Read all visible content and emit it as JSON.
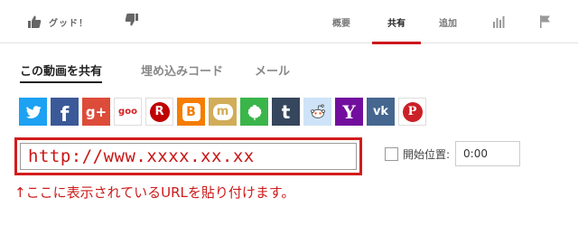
{
  "action_bar": {
    "like_label": "グッド！",
    "tabs": [
      {
        "label": "概要"
      },
      {
        "label": "共有"
      },
      {
        "label": "追加"
      }
    ]
  },
  "share": {
    "subtabs": [
      {
        "label": "この動画を共有"
      },
      {
        "label": "埋め込みコード"
      },
      {
        "label": "メール"
      }
    ],
    "services": [
      {
        "name": "twitter",
        "glyph": "",
        "color": "#1da1f2"
      },
      {
        "name": "facebook",
        "glyph": "f",
        "color": "#3b5998"
      },
      {
        "name": "google-plus",
        "glyph": "g+",
        "color": "#dd4b39"
      },
      {
        "name": "goo",
        "glyph": "goo",
        "color": "#ffffff"
      },
      {
        "name": "rakuten",
        "glyph": "R",
        "color": "#ffffff"
      },
      {
        "name": "blogger",
        "glyph": "B",
        "color": "#f57d00"
      },
      {
        "name": "mixi",
        "glyph": "m",
        "color": "#d1ad59"
      },
      {
        "name": "hatena",
        "glyph": "",
        "color": "#3ab54a"
      },
      {
        "name": "tumblr",
        "glyph": "t",
        "color": "#36465d"
      },
      {
        "name": "reddit",
        "glyph": "",
        "color": "#cee3f8"
      },
      {
        "name": "yahoo",
        "glyph": "Y",
        "color": "#720e9e"
      },
      {
        "name": "vk",
        "glyph": "vk",
        "color": "#45668e"
      },
      {
        "name": "pinterest",
        "glyph": "P",
        "color": "#ffffff"
      }
    ],
    "url": "http://www.xxxx.xx.xx",
    "start_time_label": "開始位置:",
    "start_time_value": "0:00"
  },
  "annotation": "↑ここに表示されているURLを貼り付けます。",
  "colors": {
    "accent_red": "#cc181e",
    "annotation_red": "#cc1a1a"
  }
}
